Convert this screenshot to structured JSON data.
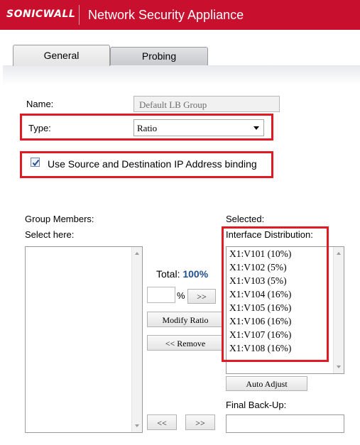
{
  "header": {
    "logo_text": "SONICWALL",
    "app_title": "Network Security Appliance",
    "brand_color": "#c8102e"
  },
  "tabs": [
    {
      "label": "General",
      "active": true
    },
    {
      "label": "Probing",
      "active": false
    }
  ],
  "form": {
    "name_label": "Name:",
    "name_value": "Default LB Group",
    "type_label": "Type:",
    "type_value": "Ratio",
    "binding_label": "Use Source and Destination IP Address binding",
    "binding_checked": true
  },
  "members": {
    "group_members_label": "Group Members:",
    "select_here_label": "Select here:",
    "selected_label": "Selected:",
    "interface_distribution_label": "Interface Distribution:",
    "total_label": "Total:",
    "total_value": "100%",
    "pct_symbol": "%",
    "distribution": [
      "X1:V101 (10%)",
      "X1:V102 (5%)",
      "X1:V103 (5%)",
      "X1:V104 (16%)",
      "X1:V105 (16%)",
      "X1:V106 (16%)",
      "X1:V107 (16%)",
      "X1:V108 (16%)"
    ]
  },
  "buttons": {
    "add_ratio": ">>",
    "modify_ratio": "Modify Ratio",
    "remove": "<< Remove",
    "auto_adjust": "Auto Adjust",
    "move_left": "<<",
    "move_right": ">>"
  },
  "backup": {
    "label": "Final Back-Up:",
    "value": ""
  },
  "highlight_color": "#e01b24"
}
